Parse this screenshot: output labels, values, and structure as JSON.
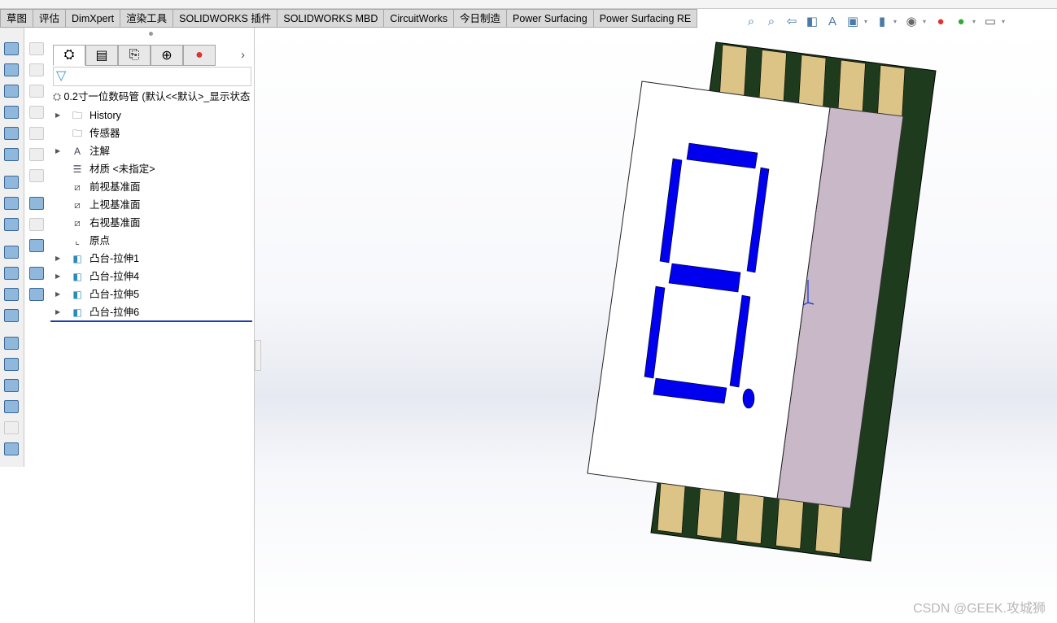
{
  "tabs": [
    "草图",
    "评估",
    "DimXpert",
    "渲染工具",
    "SOLIDWORKS 插件",
    "SOLIDWORKS MBD",
    "CircuitWorks",
    "今日制造",
    "Power Surfacing",
    "Power Surfacing RE"
  ],
  "view_toolbar": [
    "zoom-to-fit-icon",
    "zoom-to-area-icon",
    "previous-view-icon",
    "section-view-icon",
    "dynamic-annotation-icon",
    "view-orientation-icon",
    "display-style-icon",
    "hide-show-items-icon",
    "edit-appearance-icon",
    "apply-scene-icon",
    "view-settings-icon"
  ],
  "panel": {
    "tabs": [
      "featuremanager-icon",
      "propertymanager-icon",
      "configurationmanager-icon",
      "dimxpert-icon",
      "display-manager-icon"
    ],
    "filter_icon": "filter-icon",
    "root": "0.2寸一位数码管  (默认<<默认>_显示状态",
    "tree": [
      {
        "label": "History",
        "icon": "history-folder-icon",
        "expandable": true
      },
      {
        "label": "传感器",
        "icon": "sensor-folder-icon",
        "expandable": false
      },
      {
        "label": "注解",
        "icon": "annotation-folder-icon",
        "expandable": true
      },
      {
        "label": "材质 <未指定>",
        "icon": "material-icon",
        "expandable": false
      },
      {
        "label": "前视基准面",
        "icon": "plane-icon",
        "expandable": false
      },
      {
        "label": "上视基准面",
        "icon": "plane-icon",
        "expandable": false
      },
      {
        "label": "右视基准面",
        "icon": "plane-icon",
        "expandable": false
      },
      {
        "label": "原点",
        "icon": "origin-icon",
        "expandable": false
      },
      {
        "label": "凸台-拉伸1",
        "icon": "extrude-icon",
        "expandable": true
      },
      {
        "label": "凸台-拉伸4",
        "icon": "extrude-icon",
        "expandable": true
      },
      {
        "label": "凸台-拉伸5",
        "icon": "extrude-icon",
        "expandable": true
      },
      {
        "label": "凸台-拉伸6",
        "icon": "extrude-icon",
        "expandable": true
      }
    ]
  },
  "model_colors": {
    "body": "#1e3b1e",
    "pin": "#dcc486",
    "pin_gap": "#2e6a2e",
    "face": "#ffffff",
    "side": "#c8b8c8",
    "segment": "#0000ee"
  },
  "watermark": "CSDN @GEEK.攻城狮"
}
